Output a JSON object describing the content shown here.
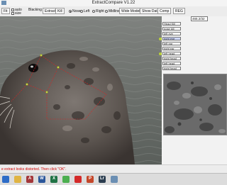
{
  "window": {
    "title": "ExtractCompare V1.22"
  },
  "toolbar": {
    "buttons": [
      "Fit",
      "Extract",
      "Kill"
    ],
    "label_auto": "auto",
    "label_size": "size",
    "label_blacking": "Blacking",
    "radios": [
      {
        "label": "Nose",
        "selected": true
      },
      {
        "label": "Left",
        "selected": false
      },
      {
        "label": "Right",
        "selected": false
      },
      {
        "label": "Midline",
        "selected": false
      }
    ],
    "right_buttons": [
      "Wide Model",
      "Show Data",
      "Comp",
      "REG"
    ]
  },
  "sidebar": {
    "coordinate_value": "465.2/32",
    "feature_items": [
      "Head Kill",
      "nose kill",
      "left eye",
      "right eye",
      "left ear",
      "right ear",
      "left head",
      "right head",
      "left head",
      "right head"
    ]
  },
  "status": {
    "message": "e extract looks distorted. Then click \"OK\"."
  },
  "taskbar": {
    "icons": [
      {
        "name": "start-icon",
        "color": "#2d6cc7",
        "glyph": ""
      },
      {
        "name": "file-explorer-icon",
        "color": "#e0b443",
        "glyph": ""
      },
      {
        "name": "access-icon",
        "color": "#a4373a",
        "glyph": "A"
      },
      {
        "name": "word-icon",
        "color": "#2b579a",
        "glyph": "W"
      },
      {
        "name": "excel-icon",
        "color": "#217346",
        "glyph": "X"
      },
      {
        "name": "chrome-icon",
        "color": "#4caf50",
        "glyph": ""
      },
      {
        "name": "acrobat-icon",
        "color": "#d42a2a",
        "glyph": ""
      },
      {
        "name": "powerpoint-icon",
        "color": "#c4472a",
        "glyph": "P"
      },
      {
        "name": "lightroom-icon",
        "color": "#2c3e50",
        "glyph": "Lr"
      },
      {
        "name": "app-icon",
        "color": "#6b8fb3",
        "glyph": ""
      }
    ]
  }
}
